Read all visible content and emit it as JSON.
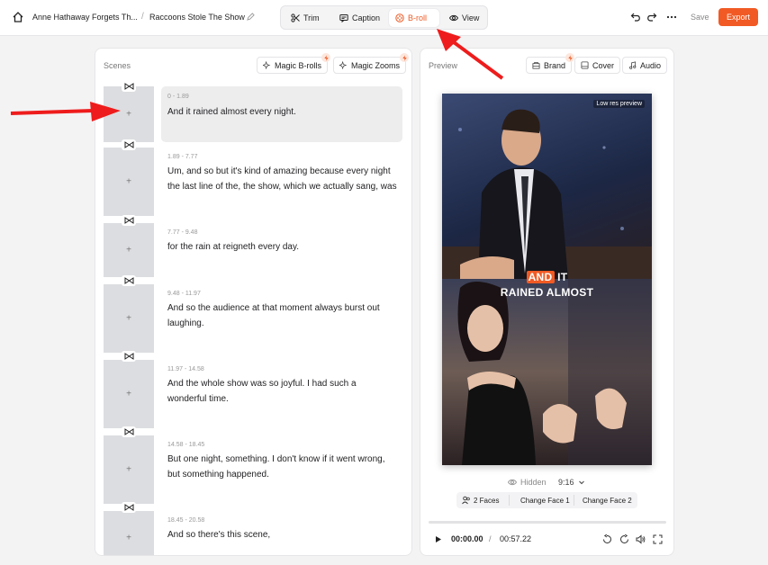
{
  "header": {
    "breadcrumb_project": "Anne Hathaway Forgets Th...",
    "breadcrumb_sep": "/",
    "breadcrumb_clip": "Raccoons Stole The Show",
    "modes": [
      {
        "label": "Trim",
        "icon": "scissors-icon"
      },
      {
        "label": "Caption",
        "icon": "caption-icon"
      },
      {
        "label": "B-roll",
        "icon": "broll-icon",
        "active": true
      },
      {
        "label": "View",
        "icon": "eye-icon"
      }
    ],
    "save_label": "Save",
    "export_label": "Export",
    "accent": "#f15a24"
  },
  "scenes": {
    "title": "Scenes",
    "magic_brolls_label": "Magic B-rolls",
    "magic_zooms_label": "Magic Zooms",
    "items": [
      {
        "time": "0 - 1.89",
        "text": "And it rained almost every night.",
        "selected": true
      },
      {
        "time": "1.89 - 7.77",
        "text": "Um, and so but it's kind of amazing because every night the last line of the, the show, which we actually sang, was"
      },
      {
        "time": "7.77 - 9.48",
        "text": "for the rain at reigneth every day."
      },
      {
        "time": "9.48 - 11.97",
        "text": "And so the audience at that moment always burst out laughing."
      },
      {
        "time": "11.97 - 14.58",
        "text": "And the whole show was so joyful. I had such a wonderful time."
      },
      {
        "time": "14.58 - 18.45",
        "text": "But one night, something. I don't know if it went wrong, but something happened."
      },
      {
        "time": "18.45 - 20.58",
        "text": "And so there's this scene,"
      }
    ],
    "add_glyph": "+"
  },
  "preview": {
    "title": "Preview",
    "brand_label": "Brand",
    "cover_label": "Cover",
    "audio_label": "Audio",
    "low_res_label": "Low res preview",
    "caption_highlight": "AND",
    "caption_rest": "IT",
    "caption_line2": "RAINED ALMOST",
    "hidden_label": "Hidden",
    "ratio_label": "9:16",
    "faces_label": "2 Faces",
    "change_face_1": "Change Face 1",
    "change_face_2": "Change Face 2",
    "current_time": "00:00.00",
    "time_sep": "/",
    "duration": "00:57.22"
  }
}
